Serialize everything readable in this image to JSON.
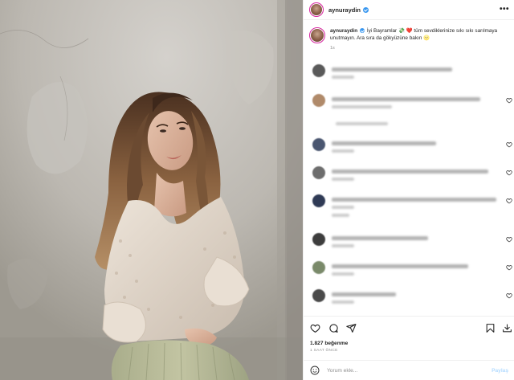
{
  "post": {
    "username": "aynuraydin",
    "more_icon": "more-horizontal-icon",
    "verified_icon": "verified-badge-icon"
  },
  "caption": {
    "username": "aynuraydin",
    "text": " İyi Bayramlar 💸 ❤️ tüm sevdiklerinize sıkı sıkı sarılmaya unutmayın. Ara sıra da gökyüzüne bakın 🌝",
    "time": "1s"
  },
  "comments_blurred": true,
  "actions": {
    "like_icon": "heart-icon",
    "comment_icon": "comment-icon",
    "share_icon": "share-icon",
    "save_icon": "bookmark-icon",
    "download_icon": "download-icon"
  },
  "likes": "1.827 beğenme",
  "time_ago": "1 SAAT ÖNCE",
  "add_comment": {
    "placeholder": "Yorum ekle...",
    "post_label": "Paylaş",
    "emoji_icon": "smiley-icon"
  },
  "colors": {
    "verified": "#3897f0",
    "text": "#262626",
    "muted": "#8e8e8e",
    "post_button_disabled": "#b3dbff"
  }
}
